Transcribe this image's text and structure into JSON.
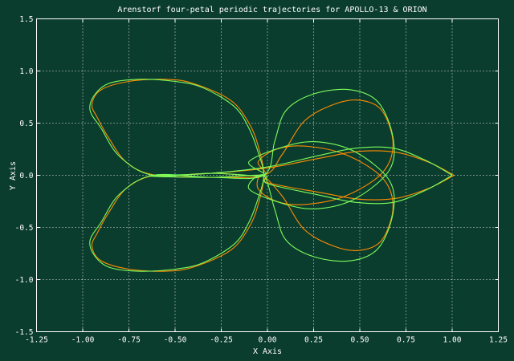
{
  "colors": {
    "background": "#0b3d2e",
    "frame": "#ffffff",
    "grid": "#dddddd",
    "text": "#ffffff"
  },
  "chart_data": {
    "type": "line",
    "title": "Arenstorf four-petal periodic trajectories for APOLLO-13 & ORION",
    "xlabel": "X Axis",
    "ylabel": "Y Axis",
    "xlim": [
      -1.25,
      1.25
    ],
    "ylim": [
      -1.5,
      1.5
    ],
    "xticks": [
      "-1.25",
      "-1.00",
      "-0.75",
      "-0.50",
      "-0.25",
      "0.00",
      "0.25",
      "0.50",
      "0.75",
      "1.00",
      "1.25"
    ],
    "yticks": [
      "1.5",
      "1.0",
      "0.5",
      "0.0",
      "-0.5",
      "-1.0",
      "-1.5"
    ],
    "grid": true,
    "legend": "none",
    "series": [
      {
        "color": "#ff8c00",
        "x": [
          1.01,
          0.88,
          0.7,
          0.5,
          0.3,
          0.0,
          -0.3,
          -0.5,
          -0.6,
          -0.3,
          -0.02,
          0.08,
          0.2,
          0.36,
          0.5,
          0.62,
          0.68,
          0.62,
          0.42,
          0.2,
          0.05,
          -0.05,
          -0.03,
          0.08,
          0.2,
          0.36,
          0.5,
          0.62,
          0.68,
          0.62,
          0.42,
          0.2,
          0.05,
          -0.05,
          -0.02,
          -0.3,
          -0.6,
          -0.76,
          -0.86,
          -0.92,
          -0.95,
          -0.9,
          -0.75,
          -0.55,
          -0.4,
          -0.2,
          -0.1,
          -0.05,
          -0.02,
          -0.05,
          -0.1,
          -0.2,
          -0.4,
          -0.55,
          -0.75,
          -0.9,
          -0.95,
          -0.92,
          -0.86,
          -0.76,
          -0.6,
          -0.3,
          -0.02,
          0.0,
          0.3,
          0.5,
          0.7,
          0.88,
          1.01
        ],
        "y": [
          0.0,
          0.12,
          0.22,
          0.23,
          0.17,
          0.07,
          0.02,
          0.0,
          -0.01,
          -0.02,
          0.0,
          0.2,
          0.52,
          0.68,
          0.72,
          0.62,
          0.3,
          0.02,
          -0.2,
          -0.28,
          -0.25,
          -0.13,
          0.0,
          -0.2,
          -0.52,
          -0.68,
          -0.72,
          -0.62,
          -0.3,
          -0.02,
          0.2,
          0.28,
          0.25,
          0.13,
          0.0,
          0.02,
          0.0,
          0.12,
          0.36,
          0.55,
          0.68,
          0.82,
          0.9,
          0.92,
          0.88,
          0.72,
          0.5,
          0.28,
          0.0,
          -0.28,
          -0.5,
          -0.72,
          -0.88,
          -0.92,
          -0.9,
          -0.82,
          -0.68,
          -0.55,
          -0.36,
          -0.12,
          0.0,
          -0.02,
          0.0,
          -0.07,
          -0.17,
          -0.23,
          -0.22,
          -0.12,
          0.0
        ]
      },
      {
        "color": "#7cfc5a",
        "x": [
          1.0,
          0.86,
          0.68,
          0.48,
          0.28,
          0.0,
          -0.3,
          -0.55,
          -0.62,
          -0.3,
          -0.02,
          0.04,
          0.1,
          0.25,
          0.45,
          0.6,
          0.68,
          0.66,
          0.48,
          0.28,
          0.1,
          -0.1,
          -0.02,
          0.04,
          0.1,
          0.25,
          0.45,
          0.6,
          0.68,
          0.66,
          0.48,
          0.28,
          0.1,
          -0.1,
          -0.02,
          -0.3,
          -0.62,
          -0.8,
          -0.9,
          -0.96,
          -0.94,
          -0.86,
          -0.7,
          -0.5,
          -0.35,
          -0.18,
          -0.1,
          -0.05,
          -0.02,
          -0.05,
          -0.1,
          -0.18,
          -0.35,
          -0.5,
          -0.7,
          -0.86,
          -0.94,
          -0.96,
          -0.9,
          -0.8,
          -0.62,
          -0.3,
          -0.02,
          0.0,
          0.28,
          0.48,
          0.68,
          0.86,
          1.0
        ],
        "y": [
          0.0,
          0.14,
          0.26,
          0.26,
          0.19,
          0.08,
          0.02,
          0.0,
          -0.01,
          -0.02,
          0.0,
          0.33,
          0.62,
          0.78,
          0.82,
          0.7,
          0.36,
          0.05,
          -0.22,
          -0.32,
          -0.28,
          -0.13,
          0.0,
          -0.33,
          -0.62,
          -0.78,
          -0.82,
          -0.7,
          -0.36,
          -0.05,
          0.22,
          0.32,
          0.28,
          0.13,
          0.0,
          0.02,
          0.0,
          0.18,
          0.45,
          0.62,
          0.76,
          0.88,
          0.92,
          0.9,
          0.84,
          0.66,
          0.45,
          0.22,
          0.0,
          -0.22,
          -0.45,
          -0.66,
          -0.84,
          -0.9,
          -0.92,
          -0.88,
          -0.76,
          -0.62,
          -0.45,
          -0.18,
          0.0,
          -0.02,
          0.0,
          -0.08,
          -0.19,
          -0.26,
          -0.26,
          -0.14,
          0.0
        ]
      }
    ]
  }
}
